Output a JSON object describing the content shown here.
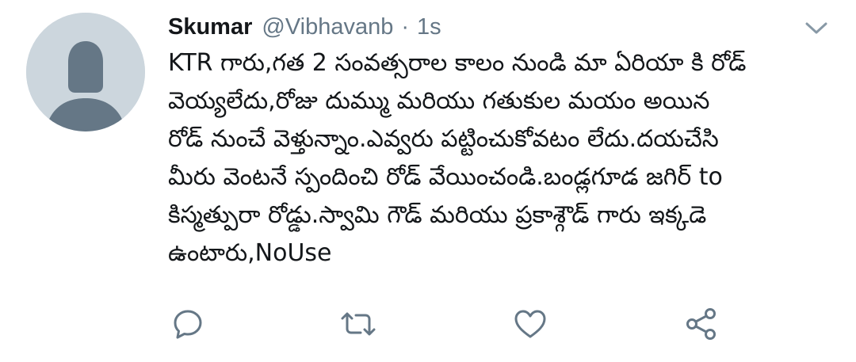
{
  "tweet": {
    "display_name": "Skumar",
    "handle": "@Vibhavanb",
    "separator": "·",
    "time": "1s",
    "text_lines": [
      "KTR గారు,గత 2 సంవత్సరాల కాలం నుండి మా ఏరియా కి రోడ్",
      "వెయ్యలేదు,రోజు దుమ్ము మరియు గతుకుల మయం అయిన",
      "రోడ్ నుంచే వెళ్తున్నాం.ఎవ్వరు పట్టించుకోవటం లేదు.దయచేసి",
      "మీరు వెంటనే స్పందించి రోడ్ వేయించండి.బండ్లగూడ జగిర్ to",
      "కిస్మత్పురా రోడ్డు.స్వామి గౌడ్ మరియు ప్రకాశ్గౌడ్ గారు ఇక్కడె",
      "ఉంటారు,NoUse"
    ]
  },
  "icons": {
    "avatar": "default-avatar-icon",
    "caret": "chevron-down-icon",
    "reply": "reply-icon",
    "retweet": "retweet-icon",
    "like": "like-icon",
    "share": "share-icon"
  },
  "colors": {
    "text": "#14171a",
    "secondary": "#657786",
    "avatar_bg": "#ccd6dd",
    "avatar_fg": "#657786",
    "icon": "#657786"
  }
}
